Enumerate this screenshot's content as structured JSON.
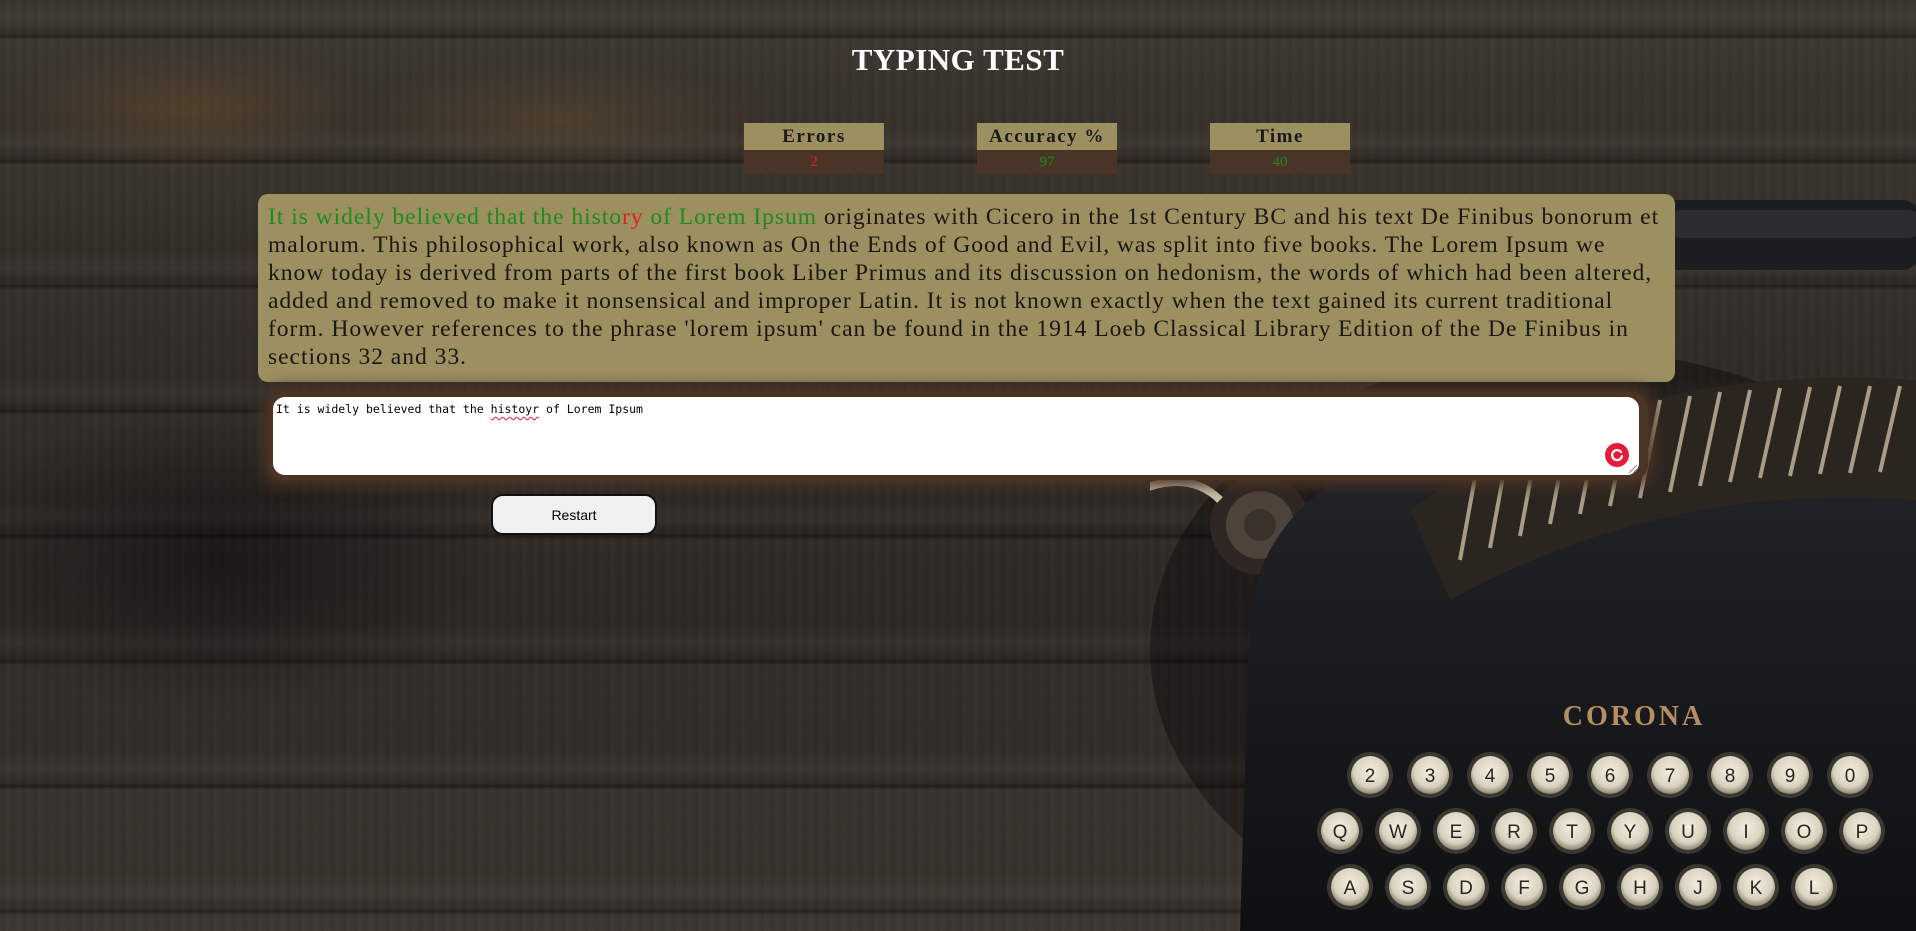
{
  "page": {
    "title": "TYPING TEST"
  },
  "stats": {
    "errors": {
      "label": "Errors",
      "value": "2",
      "color": "#e0201a"
    },
    "accuracy": {
      "label": "Accuracy %",
      "value": "97",
      "color": "#1f8a1f"
    },
    "time": {
      "label": "Time",
      "value": "40",
      "color": "#1f8a1f"
    }
  },
  "quote": {
    "correct_1": "It is widely believed that the histo",
    "wrong": "ry",
    "correct_2": " of Lorem Ipsum",
    "remaining": " originates with Cicero in the 1st Century BC and his text De Finibus bonorum et malorum. This philosophical work, also known as On the Ends of Good and Evil, was split into five books. The Lorem Ipsum we know today is derived from parts of the first book Liber Primus and its discussion on hedonism, the words of which had been altered, added and removed to make it nonsensical and improper Latin. It is not known exactly when the text gained its current traditional form. However references to the phrase 'lorem ipsum' can be found in the 1914 Loeb Classical Library Edition of the De Finibus in sections 32 and 33."
  },
  "input": {
    "before": "It is widely believed that the ",
    "misspelt": "histoyr",
    "after": " of Lorem Ipsum"
  },
  "restart_label": "Restart",
  "icons": {
    "grammar": "grammar-check-icon",
    "typewriter": "typewriter-image"
  },
  "typewriter_brand": "CORONA",
  "typewriter_keys_row1": [
    "2",
    "3",
    "4",
    "5",
    "6",
    "7",
    "8",
    "9",
    "0"
  ],
  "typewriter_keys_row2": [
    "Q",
    "W",
    "E",
    "R",
    "T",
    "Y",
    "U",
    "I",
    "O",
    "P"
  ],
  "typewriter_keys_row3": [
    "A",
    "S",
    "D",
    "F",
    "G",
    "H",
    "J",
    "K",
    "L"
  ]
}
